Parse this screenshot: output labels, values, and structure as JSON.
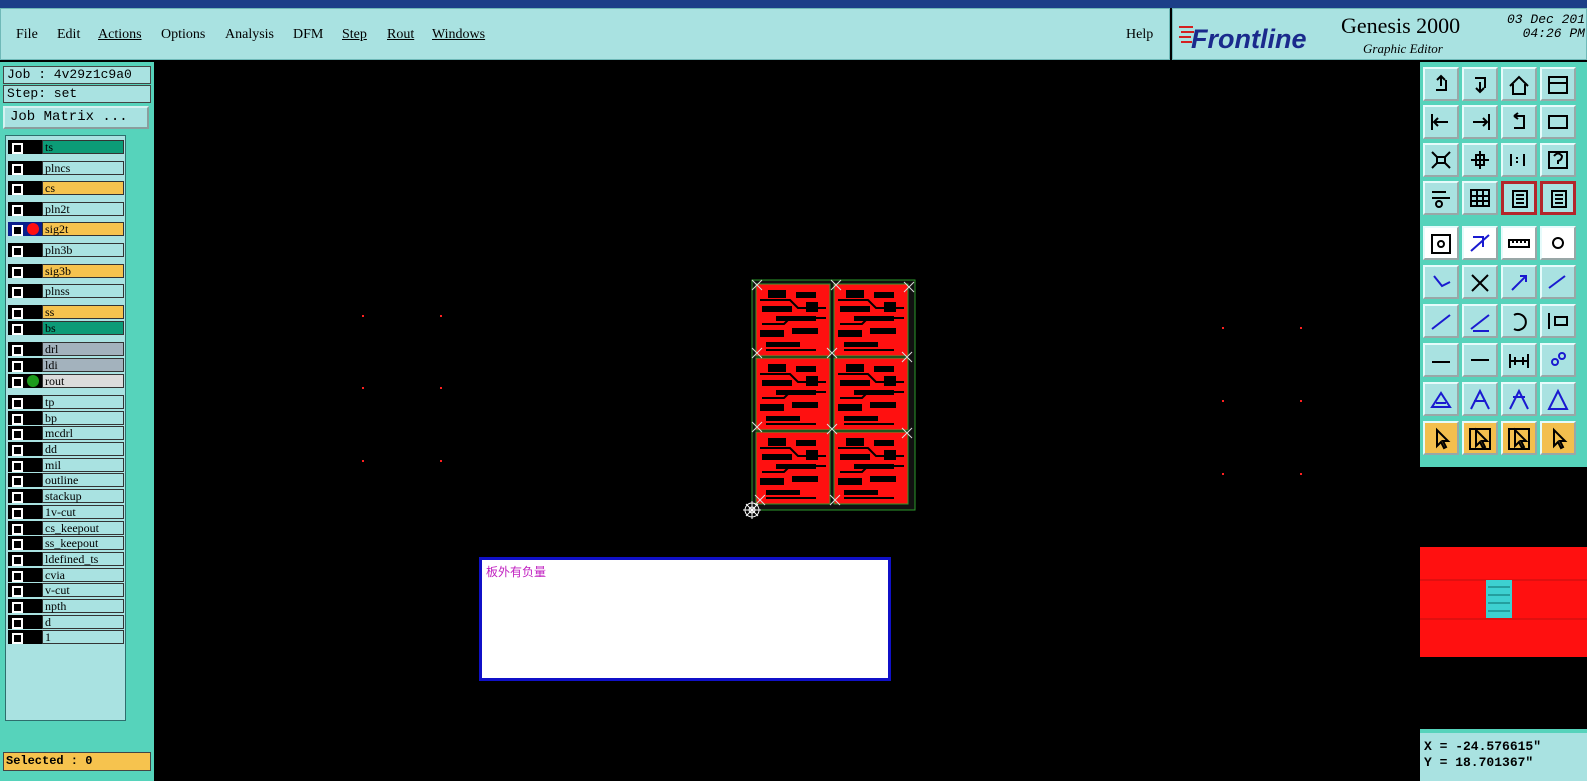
{
  "title_bar": "",
  "menu": {
    "items": [
      "File",
      "Edit",
      "Actions",
      "Options",
      "Analysis",
      "DFM",
      "Step",
      "Rout",
      "Windows"
    ],
    "help": "Help"
  },
  "brand": {
    "logo": "Frontline",
    "product": "Genesis 2000",
    "subtitle": "Graphic Editor",
    "date": "03 Dec 201",
    "time": "04:26 PM"
  },
  "left_panel": {
    "job": "Job : 4v29z1c9a0",
    "step": "Step: set",
    "job_matrix": "Job Matrix ...",
    "selected": "Selected : 0"
  },
  "layers": [
    {
      "name": "ts",
      "color": "#0c9b77"
    },
    {
      "name": "plncs",
      "color": "#a9e2e1"
    },
    {
      "name": "cs",
      "color": "#f6c34e"
    },
    {
      "name": "pln2t",
      "color": "#a9e2e1"
    },
    {
      "name": "sig2t",
      "color": "#f6c34e",
      "active": true,
      "dot": "#ff1010"
    },
    {
      "name": "pln3b",
      "color": "#a9e2e1"
    },
    {
      "name": "sig3b",
      "color": "#f6c34e"
    },
    {
      "name": "plnss",
      "color": "#a9e2e1"
    },
    {
      "name": "ss",
      "color": "#f6c34e"
    },
    {
      "name": "bs",
      "color": "#0c9b77"
    },
    {
      "name": "drl",
      "color": "#a3b2bd"
    },
    {
      "name": "ldi",
      "color": "#a3b2bd"
    },
    {
      "name": "rout",
      "color": "#dcdcdc",
      "dot": "#1c9a1c"
    },
    {
      "name": "tp",
      "color": "#a9e2e1"
    },
    {
      "name": "bp",
      "color": "#a9e2e1"
    },
    {
      "name": "mcdrl",
      "color": "#a9e2e1"
    },
    {
      "name": "dd",
      "color": "#a9e2e1"
    },
    {
      "name": "mil",
      "color": "#a9e2e1"
    },
    {
      "name": "outline",
      "color": "#a9e2e1"
    },
    {
      "name": "stackup",
      "color": "#a9e2e1"
    },
    {
      "name": "1v-cut",
      "color": "#a9e2e1"
    },
    {
      "name": "cs_keepout",
      "color": "#a9e2e1"
    },
    {
      "name": "ss_keepout",
      "color": "#a9e2e1"
    },
    {
      "name": "ldefined_ts",
      "color": "#a9e2e1"
    },
    {
      "name": "cvia",
      "color": "#a9e2e1"
    },
    {
      "name": "v-cut",
      "color": "#a9e2e1"
    },
    {
      "name": "npth",
      "color": "#a9e2e1"
    },
    {
      "name": "d",
      "color": "#a9e2e1"
    },
    {
      "name": "1",
      "color": "#a9e2e1"
    }
  ],
  "toolbar_groups": {
    "view": [
      "zoom-in",
      "zoom-out",
      "home",
      "window",
      "pan-left",
      "pan-right",
      "undo",
      "redo",
      "fit",
      "fit-profile",
      "one-to-one",
      "help",
      "settings",
      "grid",
      "layers",
      "layers-alt"
    ],
    "edit": [
      "snap",
      "measure",
      "ruler",
      "pad",
      "connect",
      "intersect",
      "move",
      "split",
      "line",
      "line-arrow",
      "arc",
      "align",
      "dot-line",
      "break",
      "distance",
      "cluster",
      "triangle",
      "triangle-a",
      "triangle-b",
      "triangle-c",
      "select",
      "select-box",
      "select-alt",
      "select-more"
    ]
  },
  "coords": {
    "x": "X = -24.576615\"",
    "y": "Y = 18.701367\""
  },
  "message": {
    "text": "板外有负量"
  },
  "colors": {
    "panel": "#56d3bb",
    "menu": "#a9e2e1",
    "copper": "#ff1010",
    "message_border": "#1010c8",
    "message_text": "#c020c0"
  }
}
